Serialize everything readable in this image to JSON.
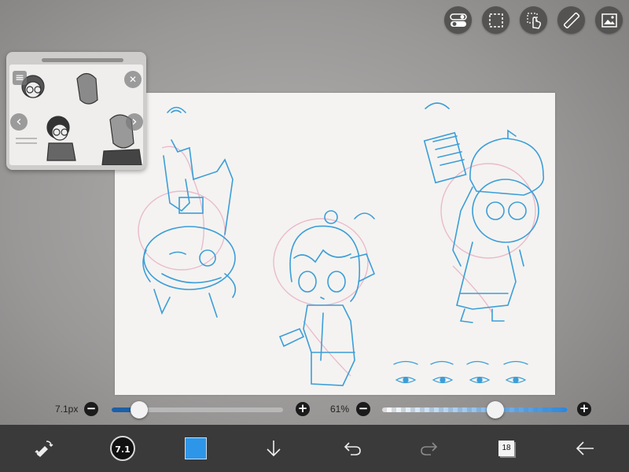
{
  "toolbar_top": {
    "icons": [
      "toggle-icon",
      "selection-icon",
      "hand-tool-icon",
      "ruler-icon",
      "image-icon"
    ]
  },
  "reference_window": {
    "close_glyph": "✕",
    "prev_glyph": "‹",
    "next_glyph": "›"
  },
  "sliders": {
    "brush_size_label": "7.1px",
    "brush_size_level": 0.16,
    "opacity_label": "61%",
    "opacity_level": 0.61,
    "minus_glyph": "−",
    "plus_glyph": "+"
  },
  "bottom_toolbar": {
    "brush_size_value": "7.1",
    "layer_count": "18",
    "current_color": "#2e96e8"
  },
  "colors": {
    "sketch_blue": "#3c9ed8",
    "sketch_pink": "#e8a7c0",
    "toolbar_bg": "#3a3a3a"
  }
}
